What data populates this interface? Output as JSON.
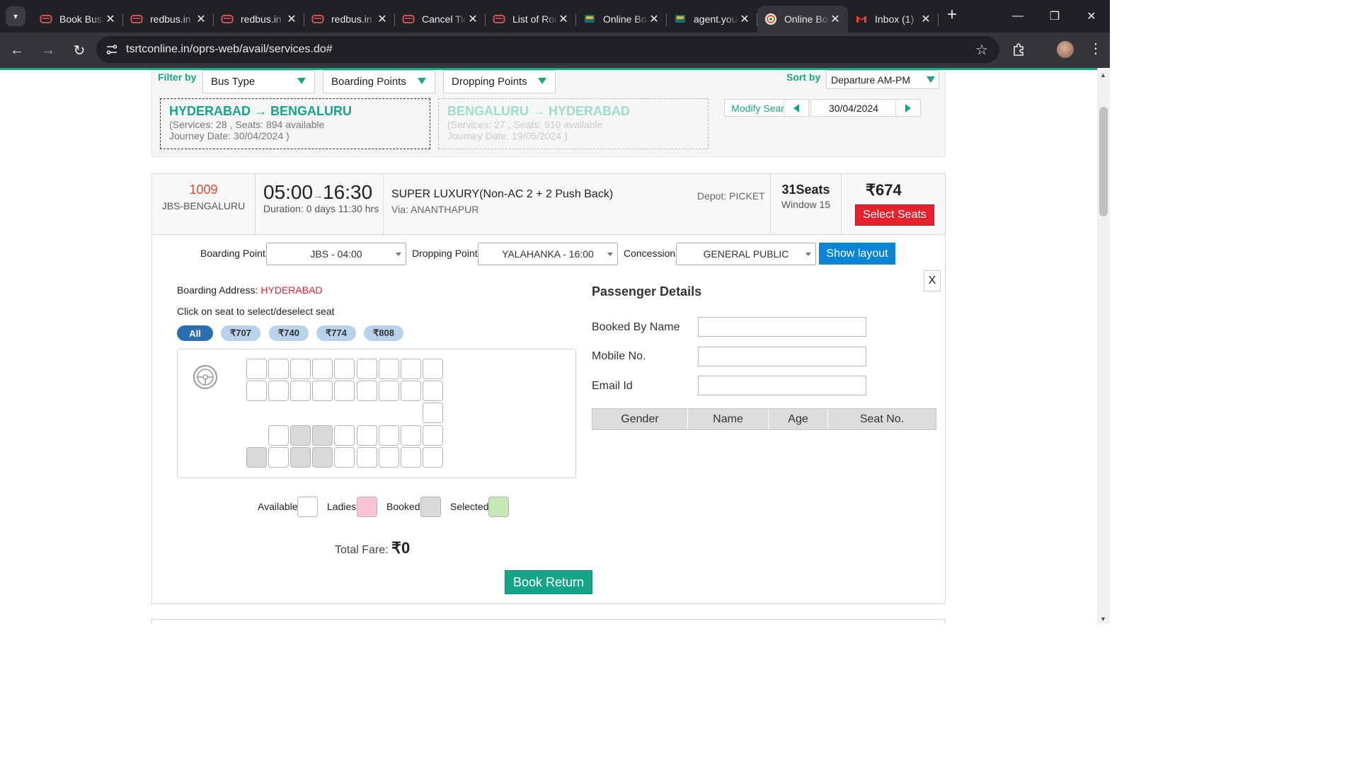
{
  "browser": {
    "tabs": [
      {
        "title": "Book Bus",
        "icon": "redbus-icon"
      },
      {
        "title": "redbus.in",
        "icon": "redbus-icon"
      },
      {
        "title": "redbus.in",
        "icon": "redbus-icon"
      },
      {
        "title": "redbus.in",
        "icon": "redbus-icon"
      },
      {
        "title": "Cancel Ticket",
        "icon": "redbus-icon"
      },
      {
        "title": "List of Routes",
        "icon": "redbus-icon"
      },
      {
        "title": "Online Booking",
        "icon": "bus-icon"
      },
      {
        "title": "agent.your",
        "icon": "bus-icon"
      },
      {
        "title": "Online Booking",
        "icon": "tsrtc-icon",
        "active": true
      },
      {
        "title": "Inbox (1)",
        "icon": "gmail-icon"
      }
    ],
    "url": "tsrtconline.in/oprs-web/avail/services.do#"
  },
  "filters": {
    "label": "Filter by",
    "bus_type": "Bus Type",
    "boarding_points": "Boarding Points",
    "dropping_points": "Dropping Points",
    "sort_label": "Sort by",
    "sort_value": "Departure AM-PM"
  },
  "routes": {
    "onward": {
      "title": "HYDERABAD → BENGALURU",
      "services": "(Services: 28 , Seats: 894 available",
      "date": "Journey Date: 30/04/2024 )"
    },
    "return": {
      "title": "BENGALURU → HYDERABAD",
      "services": "(Services: 27 , Seats: 910 available",
      "date": "Journey Date: 19/05/2024 )"
    },
    "modify_search": "Modify Search",
    "date": "30/04/2024"
  },
  "service": {
    "number": "1009",
    "name": "JBS-BENGALURU",
    "depart": "05:00",
    "arrow": "→",
    "arrive": "16:30",
    "duration": "Duration: 0 days 11:30 hrs",
    "bus_type": "SUPER LUXURY(Non-AC 2 + 2 Push Back)",
    "via": "Via: ANANTHAPUR",
    "depot": "Depot: PICKET",
    "seats": "31Seats",
    "window": "Window 15",
    "fare": "₹674",
    "select_seats": "Select Seats"
  },
  "booking": {
    "boarding_label": "Boarding Point",
    "boarding_value": "JBS - 04:00",
    "dropping_label": "Dropping Point",
    "dropping_value": "YALAHANKA - 16:00",
    "concession_label": "Concession",
    "concession_value": "GENERAL PUBLIC",
    "show_layout": "Show layout",
    "close": "X",
    "boarding_address_label": "Boarding Address:",
    "boarding_address": "HYDERABAD",
    "click_info": "Click on seat to select/deselect seat",
    "fare_filters": [
      "All",
      "₹707",
      "₹740",
      "₹774",
      "₹808"
    ],
    "legend": {
      "available": "Available",
      "ladies": "Ladies",
      "booked": "Booked",
      "selected": "Selected"
    },
    "total_label": "Total Fare:",
    "total_value": "₹0",
    "book_return": "Book Return"
  },
  "passenger": {
    "title": "Passenger Details",
    "booked_by": "Booked By Name",
    "mobile": "Mobile No.",
    "email": "Email Id",
    "columns": [
      "Gender",
      "Name",
      "Age",
      "Seat No."
    ]
  },
  "colors": {
    "accent": "#16a587",
    "danger": "#e8202e",
    "primary": "#0a85d6",
    "ladies": "#f9c4d8",
    "selected": "#c6e9b3",
    "booked": "#d9d9d9"
  }
}
